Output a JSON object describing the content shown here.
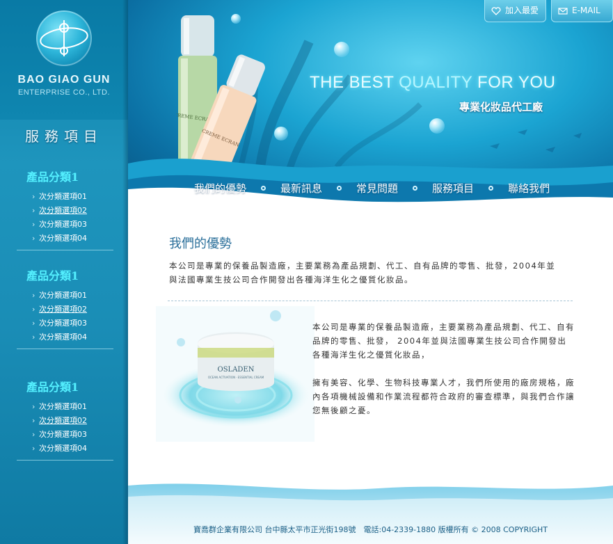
{
  "brand": {
    "name": "BAO GIAO GUN",
    "subtitle": "ENTERPRISE CO., LTD."
  },
  "sidebar": {
    "heading": "服務項目",
    "groups": [
      {
        "title": "產品分類1",
        "items": [
          "次分類選項01",
          "次分類選項02",
          "次分類選項03",
          "次分類選項04"
        ]
      },
      {
        "title": "產品分類1",
        "items": [
          "次分類選項01",
          "次分類選項02",
          "次分類選項03",
          "次分類選項04"
        ]
      },
      {
        "title": "產品分類1",
        "items": [
          "次分類選項01",
          "次分類選項02",
          "次分類選項03",
          "次分類選項04"
        ]
      }
    ]
  },
  "header": {
    "favorite_label": "加入最愛",
    "email_label": "E-MAIL",
    "slogan_part1": "THE BEST ",
    "slogan_highlight": "QUALITY",
    "slogan_part2": " FOR YOU",
    "slogan_cn": "專業化妝品代工廠",
    "bottle1_label": "CREME ECRAN TO",
    "bottle2_label": "CREME ECRAN"
  },
  "nav": [
    "我們的優勢",
    "最新訊息",
    "常見問題",
    "服務項目",
    "聯絡我們"
  ],
  "main": {
    "title": "我們的優勢",
    "intro": "本公司是專業的保養品製造廠，主要業務為產品規劃、代工、自有品牌的零售、批發，2004年並與法國專業生技公司合作開發出各種海洋生化之優質化妝品。",
    "product_label": "OSLADEN",
    "product_sub": "OCEAN ACTIVATION · ESSENTIAL CREAM",
    "desc1": "本公司是專業的保養品製造廠，主要業務為產品規劃、代工、自有品牌的零售、批發， 2004年並與法國專業生技公司合作開發出各種海洋生化之優質化妝品，",
    "desc2": "擁有美容、化學、生物科技專業人才，我們所使用的廠房規格，廠內各項機械設備和作業流程都符合政府的審查標準，與我們合作讓您無後顧之憂。"
  },
  "footer": {
    "text": "寶喬群企業有限公司 台中縣太平市正光街198號　電話:04-2339-1880 版權所有 © 2008 COPYRIGHT"
  },
  "colors": {
    "sidebar": "#1a8db6",
    "accent_title": "#54f0ff",
    "heading_blue": "#2a6f9a"
  }
}
